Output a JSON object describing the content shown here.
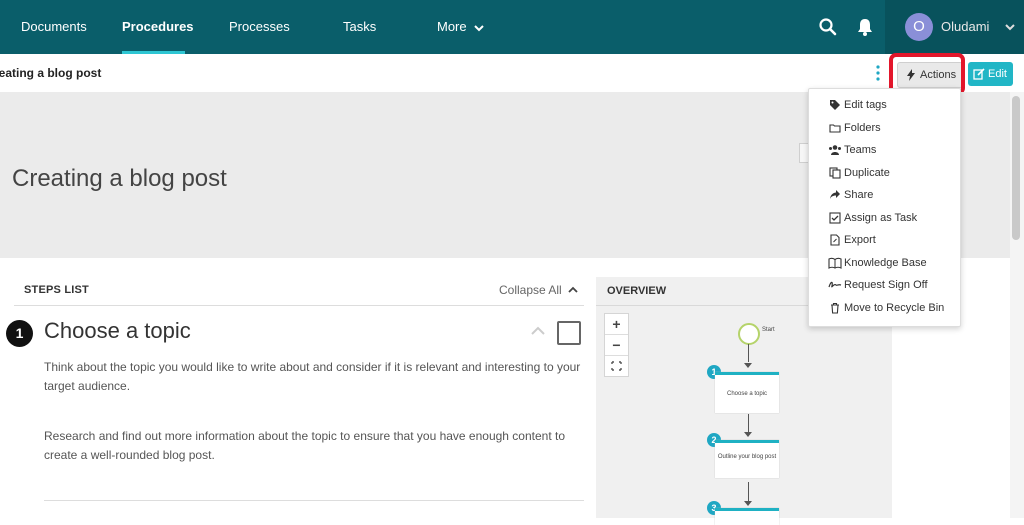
{
  "nav": {
    "items": [
      {
        "label": "Documents"
      },
      {
        "label": "Procedures"
      },
      {
        "label": "Processes"
      },
      {
        "label": "Tasks"
      },
      {
        "label": "More"
      }
    ],
    "user": {
      "initial": "O",
      "name": "Oludami"
    }
  },
  "subheader": {
    "title": "reating a blog post",
    "actions_label": "Actions",
    "edit_label": "Edit"
  },
  "hero": {
    "title": "Creating a blog post"
  },
  "steps": {
    "header": "STEPS LIST",
    "collapse_label": "Collapse All",
    "step1": {
      "number": "1",
      "title": "Choose a topic",
      "para1": "Think about the topic you would like to write about and consider if it is relevant and interesting to your target audience.",
      "para2": "Research and find out more information about the topic to ensure that you have enough content to create a well-rounded blog post."
    }
  },
  "overview": {
    "title": "OVERVIEW",
    "zoom_in": "+",
    "zoom_out": "−",
    "start_label": "Start",
    "nodes": [
      {
        "num": "1",
        "label": "Choose a topic"
      },
      {
        "num": "2",
        "label": "Outline your blog post"
      },
      {
        "num": "3",
        "label": ""
      }
    ]
  },
  "menu": {
    "items": [
      {
        "label": "Edit tags",
        "icon": "tag-icon"
      },
      {
        "label": "Folders",
        "icon": "folder-icon"
      },
      {
        "label": "Teams",
        "icon": "users-icon"
      },
      {
        "label": "Duplicate",
        "icon": "copy-icon"
      },
      {
        "label": "Share",
        "icon": "share-icon"
      },
      {
        "label": "Assign as Task",
        "icon": "check-square-icon"
      },
      {
        "label": "Export",
        "icon": "file-export-icon"
      },
      {
        "label": "Knowledge Base",
        "icon": "book-icon"
      },
      {
        "label": "Request Sign Off",
        "icon": "signature-icon"
      },
      {
        "label": "Move to Recycle Bin",
        "icon": "trash-icon"
      }
    ]
  },
  "colors": {
    "nav_bg": "#0a5e6a",
    "accent": "#21b6c6",
    "highlight": "#e3162b"
  }
}
